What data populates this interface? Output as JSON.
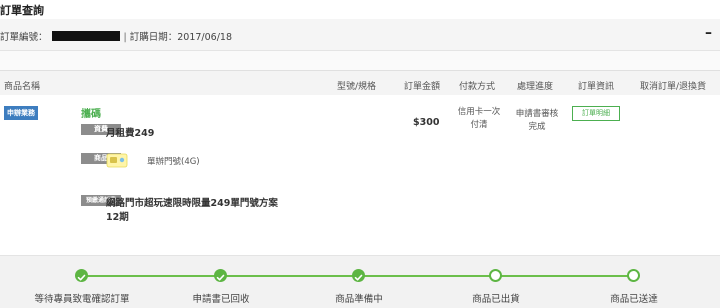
{
  "page": {
    "title": "訂單查詢"
  },
  "order": {
    "number_label": "訂單編號：",
    "date_label": "訂購日期：",
    "date": "2017/06/18",
    "collapse_symbol": "–"
  },
  "columns": {
    "product": "商品名稱",
    "model": "型號/規格",
    "amount": "訂單金額",
    "payment": "付款方式",
    "progress": "處理進度",
    "info": "訂單資訊",
    "cancel": "取消訂單/退換貨"
  },
  "item": {
    "badge": "申辦業務",
    "plan_name": "攜碼",
    "lines": [
      {
        "tag": "資費",
        "text": "月租費249"
      },
      {
        "tag": "商品",
        "text": "單辦門號(4G)"
      },
      {
        "tag": "預繳通話費",
        "text": "網路門市超玩速限時限量249單門號方案",
        "text2": "12期"
      }
    ],
    "amount": "$300",
    "payment_line1": "信用卡一次",
    "payment_line2": "付清",
    "status_line1": "申請書審核",
    "status_line2": "完成",
    "detail_button": "訂單明細"
  },
  "progress_steps": [
    {
      "label": "等待專員致電確認訂單",
      "done": true
    },
    {
      "label": "申請書已回收",
      "done": true
    },
    {
      "label": "商品準備中",
      "done": true
    },
    {
      "label": "商品已出貨",
      "done": false
    },
    {
      "label": "商品已送達",
      "done": false
    }
  ],
  "colors": {
    "accent_green": "#5db543",
    "badge_blue": "#3d7dbf",
    "tag_gray": "#8c8c8c"
  },
  "icons": {
    "done": "check-icon",
    "todo": "circle-icon"
  }
}
